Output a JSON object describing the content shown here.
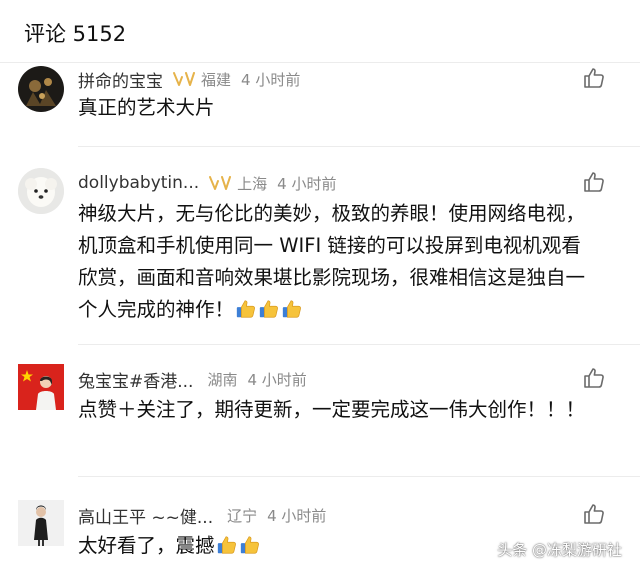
{
  "header": {
    "title": "评论 5152"
  },
  "comments": [
    {
      "username": "拼命的宝宝",
      "vip": true,
      "location": "福建",
      "time": "4 小时前",
      "content": "真正的艺术大片",
      "thumbs": 0
    },
    {
      "username": "dollybabytin...",
      "vip": true,
      "location": "上海",
      "time": "4 小时前",
      "content": "神级大片，无与伦比的美妙，极致的养眼！使用网络电视，机顶盒和手机使用同一 WIFI 链接的可以投屏到电视机观看欣赏，画面和音响效果堪比影院现场，很难相信这是独自一个人完成的神作！",
      "thumbs": 3
    },
    {
      "username": "兔宝宝#香港...",
      "vip": false,
      "location": "湖南",
      "time": "4 小时前",
      "content": "点赞＋关注了，期待更新，一定要完成这一伟大创作！！！",
      "thumbs": 0
    },
    {
      "username": "高山王平 ~~健...",
      "vip": false,
      "location": "辽宁",
      "time": "4 小时前",
      "content": "太好看了，震撼",
      "thumbs": 2
    }
  ],
  "icons": {
    "like": "thumbs-up-outline-icon",
    "vip": "vip-badge-icon",
    "thumb_emoji": "thumbs-up-emoji-icon"
  },
  "colors": {
    "text": "#111111",
    "meta": "#8a8a8a",
    "vip_gold": "#e6b34a",
    "emoji_yellow": "#f6c33b",
    "divider": "#ececec"
  },
  "watermark": "头条 @冻梨游研社"
}
